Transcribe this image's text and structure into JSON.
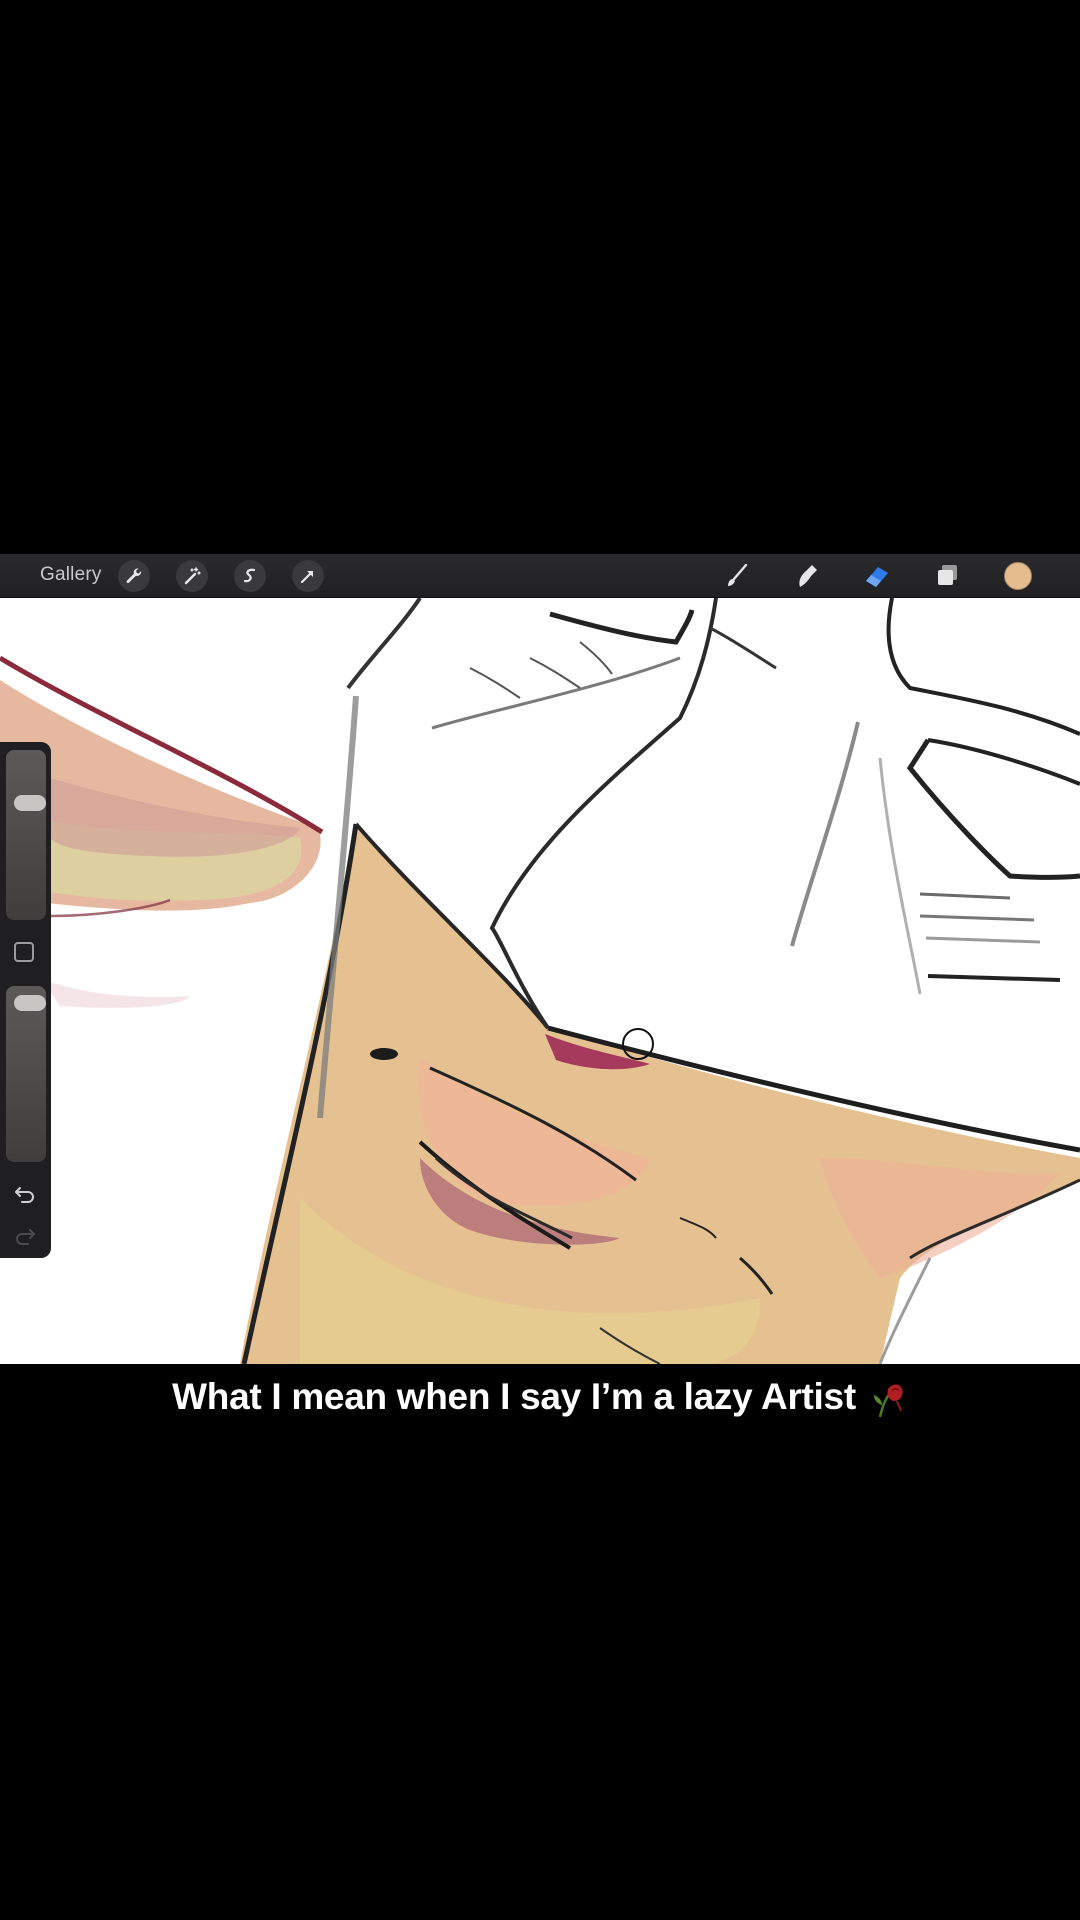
{
  "toolbar": {
    "gallery_label": "Gallery",
    "left_tools": [
      "wrench-icon",
      "magic-wand-icon",
      "selection-icon",
      "transform-arrow-icon"
    ],
    "right_tools": [
      "brush-icon",
      "smudge-icon",
      "eraser-icon",
      "layers-icon"
    ],
    "active_tool": "eraser",
    "current_color": "#E5BC8E",
    "accent_color": "#2F7BEA"
  },
  "sidebar": {
    "brush_size_level": 0.72,
    "opacity_level": 0.03,
    "icons": [
      "undo-icon",
      "redo-icon"
    ]
  },
  "caption": {
    "text": "What I mean when I say I’m a lazy Artist",
    "emoji": "wilted-rose-emoji"
  }
}
